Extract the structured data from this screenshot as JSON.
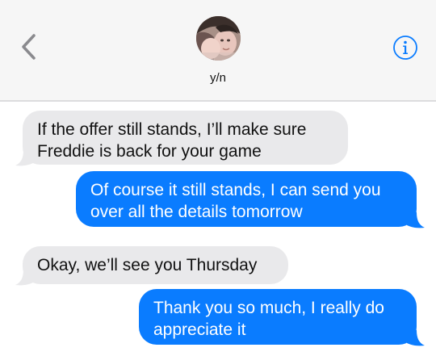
{
  "header": {
    "contact_name": "y/n",
    "back_icon": "chevron-left-icon",
    "info_icon": "info-icon"
  },
  "colors": {
    "header_bg": "#f6f6f6",
    "received_bg": "#e9e9eb",
    "sent_bg": "#0a7cff",
    "accent": "#0a7cff"
  },
  "messages": [
    {
      "direction": "received",
      "text": "If the offer still stands, I’ll make sure\nFreddie is back for your game"
    },
    {
      "direction": "sent",
      "text": "Of course it still stands, I can send you\nover all the details tomorrow"
    },
    {
      "direction": "received",
      "text": "Okay, we’ll see you Thursday"
    },
    {
      "direction": "sent",
      "text": "Thank you so much, I really do\nappreciate it"
    }
  ]
}
